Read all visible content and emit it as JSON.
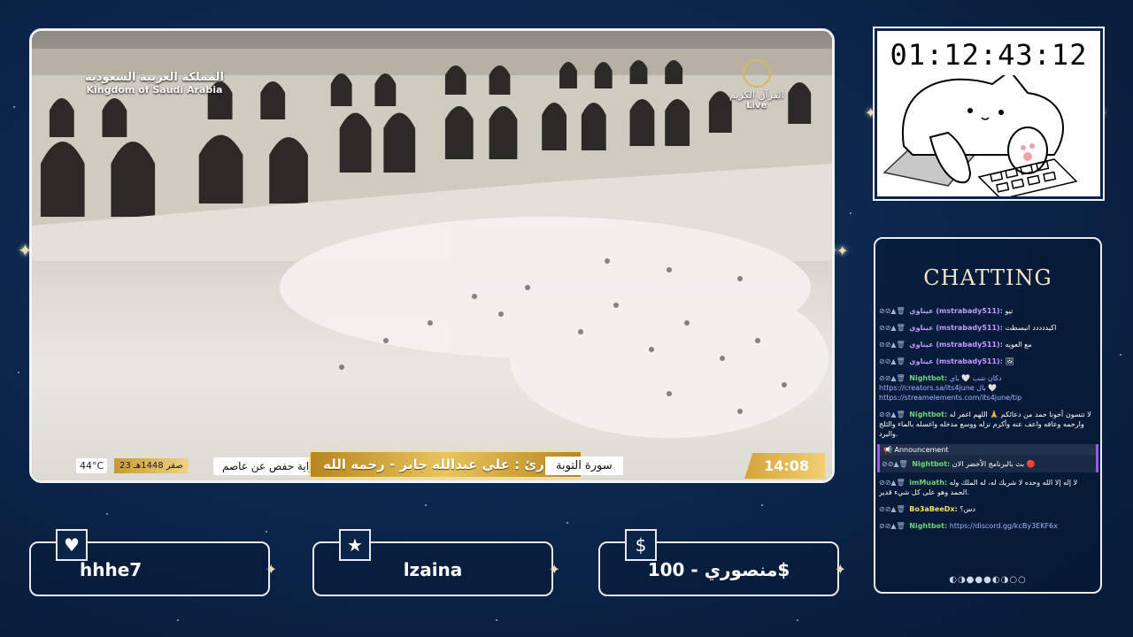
{
  "video": {
    "ksa_arabic": "المملكة العربية السعودية",
    "ksa_english": "Kingdom of Saudi Arabia",
    "channel_arabic": "القرآن الكريم",
    "channel_live": "Live",
    "temperature": "44°C",
    "hijri_date": "23 صفر 1448هـ",
    "riwaya": "رواية حفص عن عاصم",
    "qari": "القارئ : علي عبدالله جابر - رحمه الله",
    "surah": "سورة التوبة",
    "clock": "14:08"
  },
  "timer": {
    "value": "01:12:43:12"
  },
  "chat": {
    "title": "CHATTING",
    "messages": [
      {
        "user": "عيناوي (mstrabady511):",
        "text": "تيو",
        "style": "purple"
      },
      {
        "user": "عيناوي (mstrabady511):",
        "text": "اكيددددد انبسطت",
        "style": "purple"
      },
      {
        "user": "عيناوي (mstrabady511):",
        "text": "مع العويه",
        "style": "purple"
      },
      {
        "user": "عيناوي (mstrabady511):",
        "text": "🖼",
        "style": "purple"
      },
      {
        "user": "Nightbot:",
        "text": "دكان شب 🤍 باي https://creators.sa/its4june بال 🤍 https://streamelements.com/its4june/tip",
        "style": "green"
      },
      {
        "user": "Nightbot:",
        "text": "لا تنسون أخونا حمد من دعائكم 🙏 اللهم اغفر له وارحمه وعافه واعف عنه وأكرم نزله ووسع مدخله واغسله بالماء والثلج والبرد.",
        "style": "green"
      }
    ],
    "announcement": {
      "label": "Announcement",
      "user": "Nightbot:",
      "text": "بث بالبرنامج الأخضر الان 🔴"
    },
    "messages_after": [
      {
        "user": "imMuath:",
        "text": "لا إله إلا الله وحده لا شريك له، له الملك وله الحمد وهو على كل شيء قدير.",
        "style": "green"
      },
      {
        "user": "Bo3aBeeDx:",
        "text": "دس؟",
        "style": "yellow"
      },
      {
        "user": "Nightbot:",
        "text": "https://discord.gg/kcBy3EKF6x",
        "style": "green"
      }
    ],
    "pager": "◐◑●●●◐◑○○"
  },
  "alerts": [
    {
      "icon": "heart-icon",
      "glyph": "♥",
      "text": "hhhe7"
    },
    {
      "icon": "star-icon",
      "glyph": "★",
      "text": "lzaina"
    },
    {
      "icon": "dollar-icon",
      "glyph": "$",
      "text": "منصوري - 100$"
    }
  ]
}
